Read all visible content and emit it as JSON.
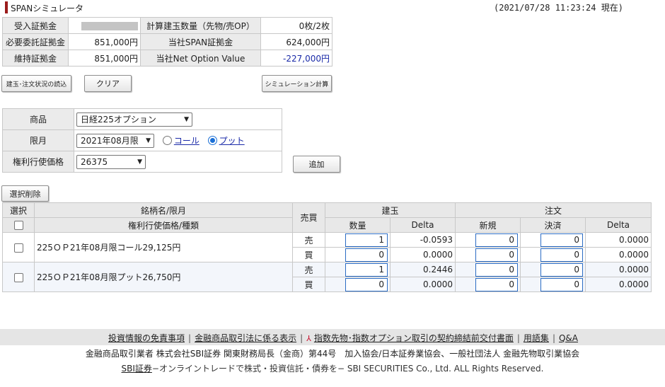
{
  "header": {
    "title": "SPANシミュレータ",
    "timestamp": "(2021/07/28 11:23:24 現在)"
  },
  "summary": {
    "row1": {
      "label1": "受入証拠金",
      "label2": "計算建玉数量（先物/売OP）",
      "value2": "0枚/2枚"
    },
    "row2": {
      "label1": "必要委託証拠金",
      "value1": "851,000円",
      "label2": "当社SPAN証拠金",
      "value2": "624,000円"
    },
    "row3": {
      "label1": "維持証拠金",
      "value1": "851,000円",
      "label2": "当社Net Option Value",
      "value2": "-227,000円"
    }
  },
  "buttons": {
    "load": "建玉･注文状況の読込",
    "clear": "クリア",
    "calc": "シミュレーション計算",
    "add": "追加",
    "delete": "選択削除"
  },
  "form": {
    "product_label": "商品",
    "product_value": "日経225オプション",
    "month_label": "限月",
    "month_value": "2021年08月限",
    "call_label": "コール",
    "put_label": "プット",
    "strike_label": "権利行使価格",
    "strike_value": "26375"
  },
  "grid": {
    "headers": {
      "select": "選択",
      "name_top": "銘柄名/限月",
      "name_bottom": "権利行使価格/種類",
      "side": "売買",
      "position": "建玉",
      "order": "注文",
      "qty": "数量",
      "delta": "Delta",
      "new": "新規",
      "settle": "決済",
      "delta2": "Delta"
    },
    "groups": [
      {
        "name": "225ＯＰ21年08月限コール29,125円",
        "rows": [
          {
            "side": "売",
            "qty": "1",
            "delta": "-0.0593",
            "new": "0",
            "settle": "0",
            "delta2": "0.0000"
          },
          {
            "side": "買",
            "qty": "0",
            "delta": "0.0000",
            "new": "0",
            "settle": "0",
            "delta2": "0.0000"
          }
        ]
      },
      {
        "name": "225ＯＰ21年08月限プット26,750円",
        "rows": [
          {
            "side": "売",
            "qty": "1",
            "delta": "0.2446",
            "new": "0",
            "settle": "0",
            "delta2": "0.0000"
          },
          {
            "side": "買",
            "qty": "0",
            "delta": "0.0000",
            "new": "0",
            "settle": "0",
            "delta2": "0.0000"
          }
        ]
      }
    ]
  },
  "footer": {
    "link1": "投資情報の免責事項",
    "link2": "金融商品取引法に係る表示",
    "link3": "指数先物･指数オプション取引の契約締結前交付書面",
    "link4": "用語集",
    "link5": "Q&A",
    "line2": "金融商品取引業者 株式会社SBI証券 関東財務局長（金商）第44号　加入協会/日本証券業協会、一般社団法人 金融先物取引業協会",
    "brand_link": "SBI証券",
    "line3_rest": "−オンライントレードで株式・投資信託・債券を− SBI SECURITIES Co., Ltd. ALL Rights Reserved."
  },
  "icons": [
    "title-bar-icon",
    "pdf-icon",
    "chevron-down-icon",
    "radio-icon",
    "checkbox-icon"
  ],
  "colors": {
    "accent": "#9b1c1c",
    "link": "#1a2aa8",
    "negative": "#1a2aa8",
    "radio": "#1a6fd6"
  }
}
